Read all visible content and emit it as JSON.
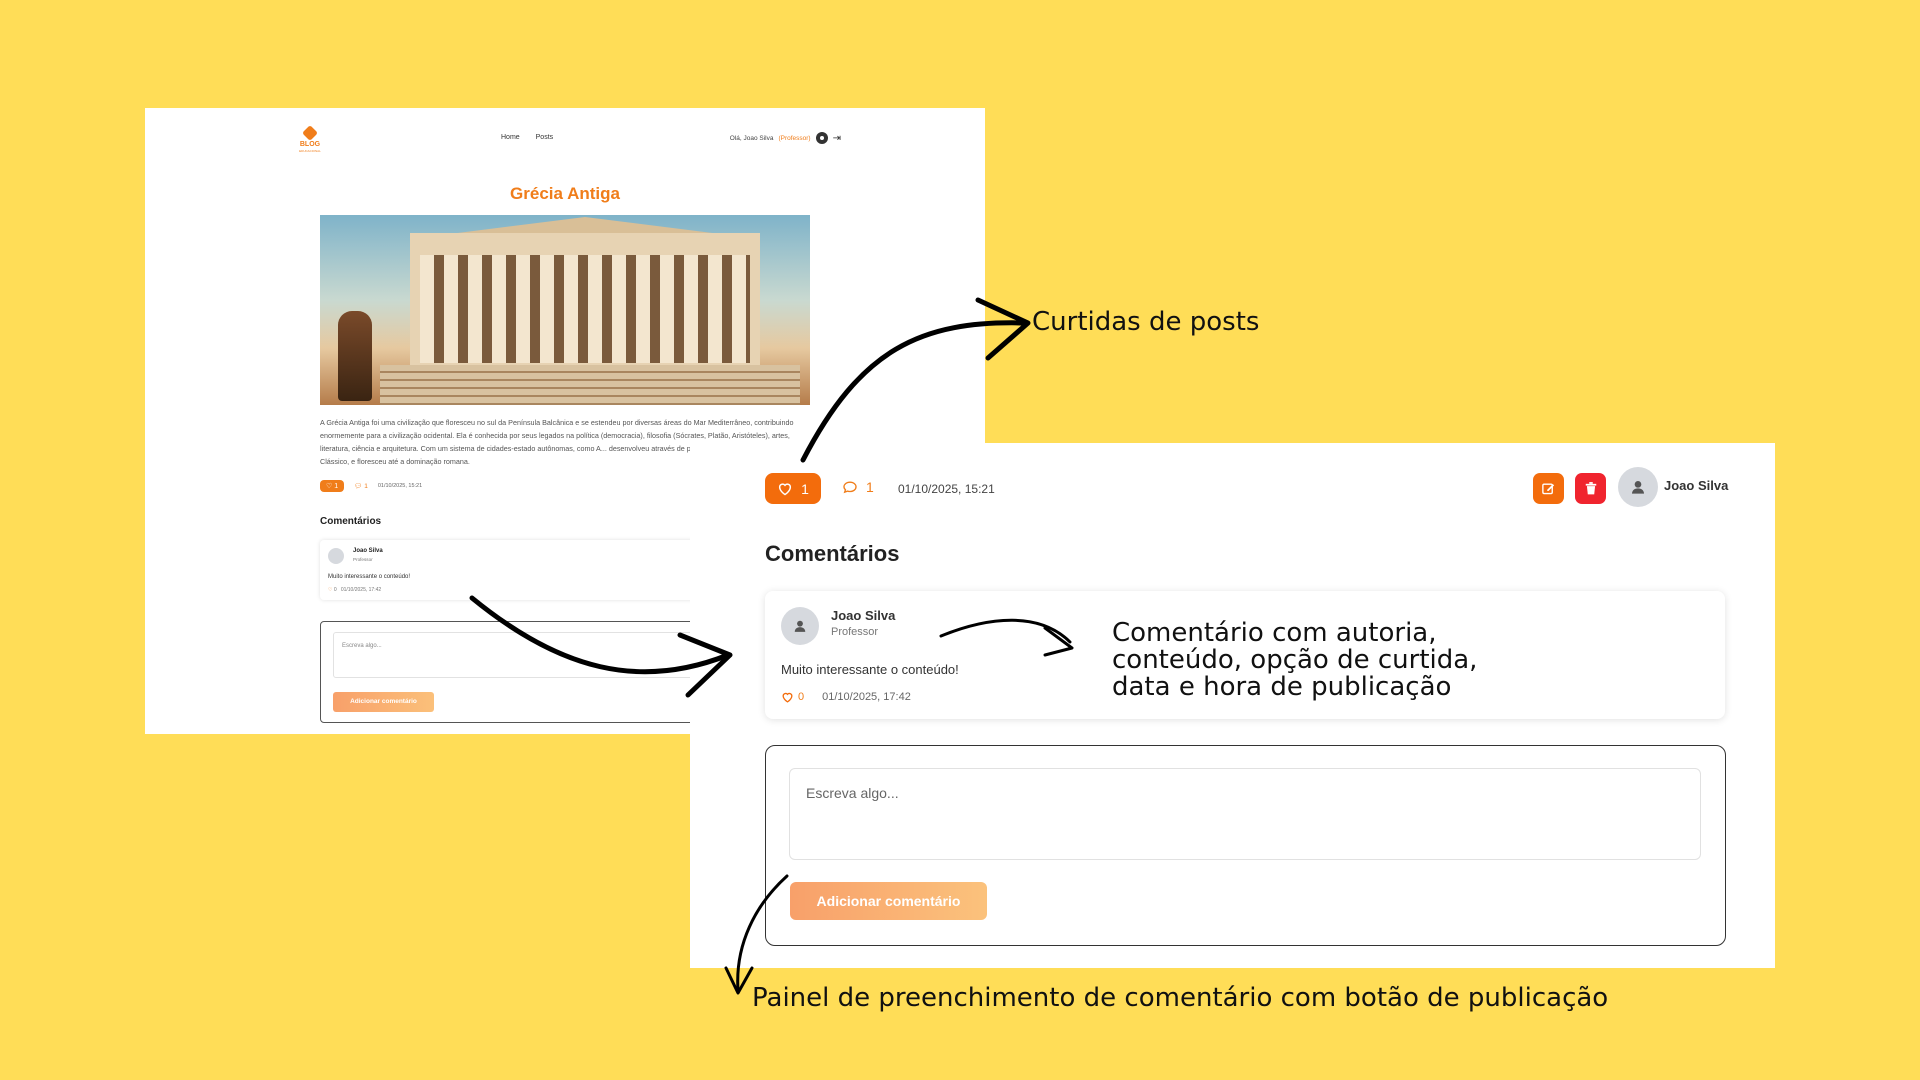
{
  "small_screenshot": {
    "logo": {
      "line1": "BLOG",
      "line2": "EDUCACIONAL"
    },
    "nav": {
      "home": "Home",
      "posts": "Posts"
    },
    "user": {
      "greeting": "Olá, Joao Silva",
      "role": "(Professor)"
    },
    "post": {
      "title": "Grécia Antiga",
      "body": "A Grécia Antiga foi uma civilização que floresceu no sul da Península Balcânica e se estendeu por diversas áreas do Mar Mediterrâneo, contribuindo enormemente para a civilização ocidental. Ela é conhecida por seus legados na política (democracia), filosofia (Sócrates, Platão, Aristóteles), artes, literatura, ciência e arquitetura. Com um sistema de cidades-estado autônomas, como A... desenvolveu através de períodos como o Homérico, Arcaico e Clássico, e floresceu até a dominação romana.",
      "likes": "1",
      "comments": "1",
      "date": "01/10/2025, 15:21"
    },
    "comments_title": "Comentários",
    "comment": {
      "author": "Joao Silva",
      "role": "Professor",
      "text": "Muito interessante o conteúdo!",
      "likes": "0",
      "date": "01/10/2025, 17:42"
    },
    "form": {
      "placeholder": "Escreva algo...",
      "button": "Adicionar comentário"
    }
  },
  "zoom_panel": {
    "post_likes": "1",
    "post_comments": "1",
    "post_date": "01/10/2025, 15:21",
    "author_name": "Joao Silva",
    "comments_title": "Comentários",
    "comment": {
      "author": "Joao Silva",
      "role": "Professor",
      "text": "Muito interessante o conteúdo!",
      "likes": "0",
      "date": "01/10/2025, 17:42"
    },
    "form": {
      "placeholder": "Escreva algo...",
      "button": "Adicionar comentário"
    }
  },
  "annotations": {
    "likes": "Curtidas de posts",
    "comment_line1": "Comentário com autoria,",
    "comment_line2": "conteúdo, opção de curtida,",
    "comment_line3": "data e hora de publicação",
    "form": "Painel de preenchimento de comentário com botão de publicação"
  },
  "colors": {
    "background": "#FFDD57",
    "accent": "#F36C0C",
    "delete": "#F0242E"
  },
  "icons": [
    "logo-cube-icon",
    "user-circle-icon",
    "logout-icon",
    "heart-icon",
    "comment-icon",
    "edit-icon",
    "trash-icon",
    "user-avatar-icon"
  ]
}
